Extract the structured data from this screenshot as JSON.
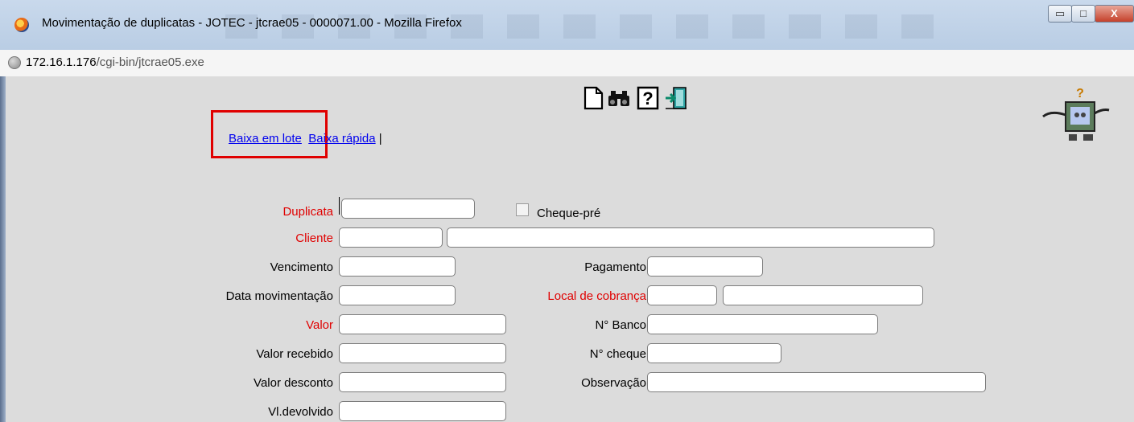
{
  "window": {
    "title": "Movimentação de duplicatas - JOTEC - jtcrae05 - 0000071.00 - Mozilla Firefox",
    "minimize": "▭",
    "maximize": "□",
    "close": "X"
  },
  "address": {
    "host": "172.16.1.176",
    "path": "/cgi-bin/jtcrae05.exe"
  },
  "toolbar": [
    "new-document",
    "search-binoculars",
    "help",
    "exit-door"
  ],
  "links": {
    "batch": "Baixa em lote",
    "quick": "Baixa rápida",
    "separator": " |"
  },
  "form": {
    "duplicata": "Duplicata",
    "cheque_pre": "Cheque-pré",
    "cliente": "Cliente",
    "vencimento": "Vencimento",
    "pagamento": "Pagamento",
    "data_movimentacao": "Data movimentação",
    "local_cobranca": "Local de cobrança",
    "valor": "Valor",
    "n_banco": "N° Banco",
    "valor_recebido": "Valor recebido",
    "n_cheque": "N° cheque",
    "valor_desconto": "Valor desconto",
    "observacao": "Observação",
    "vl_devolvido": "Vl.devolvido"
  },
  "colors": {
    "required_label": "#e00000",
    "link": "#0000ee",
    "highlight_box": "#e00000"
  }
}
